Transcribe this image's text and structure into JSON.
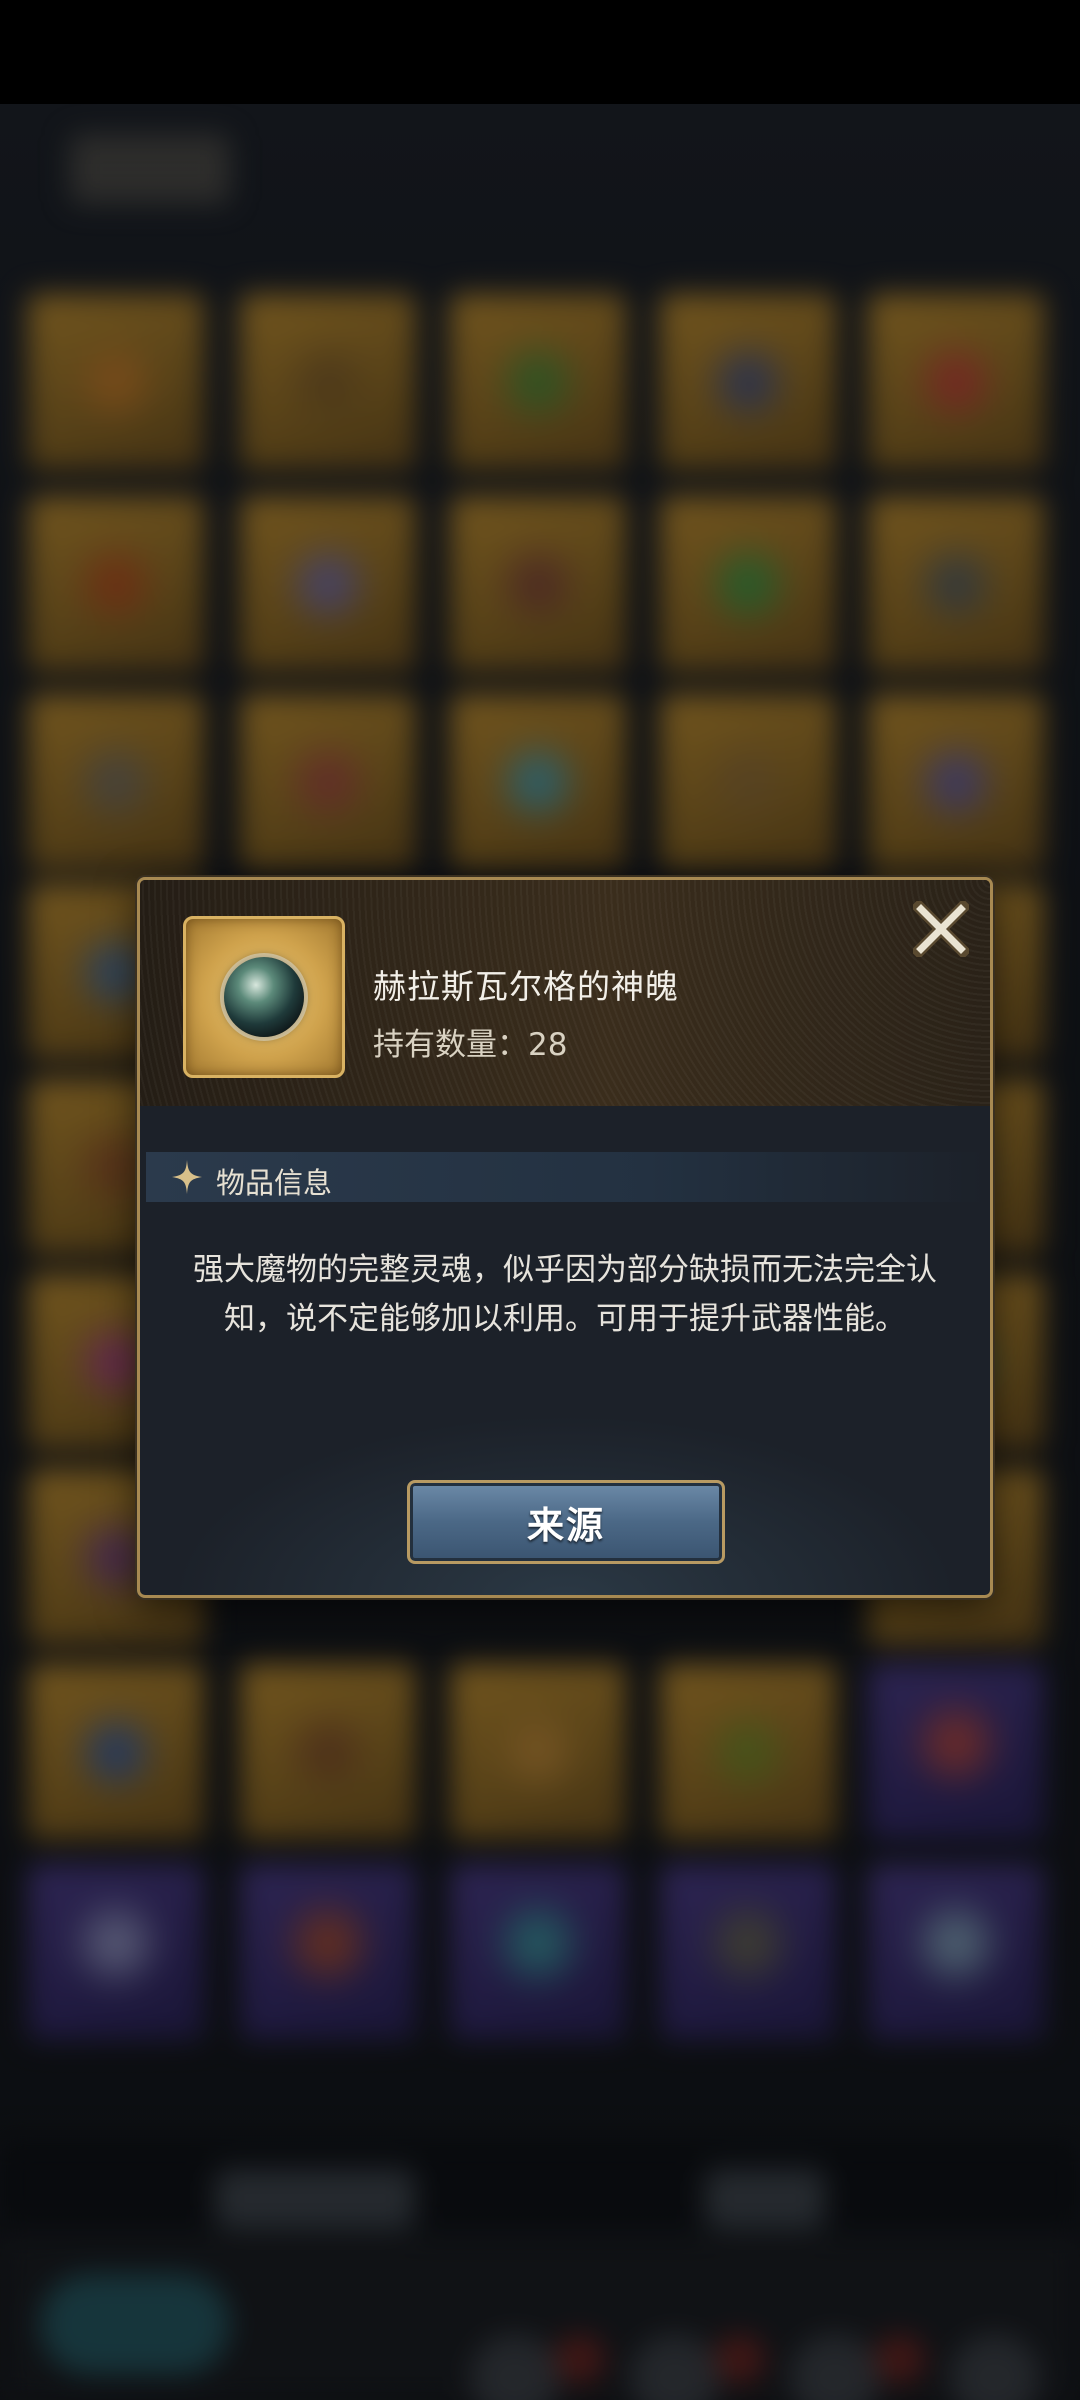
{
  "item": {
    "name": "赫拉斯瓦尔格的神魄",
    "count_label": "持有数量：28",
    "icon": "soul-orb-icon"
  },
  "section": {
    "title": "物品信息",
    "icon": "sparkle-icon"
  },
  "description": "强大魔物的完整灵魂，似乎因为部分缺损而无法完全认知，说不定能够加以利用。可用于提升武器性能。",
  "buttons": {
    "source_label": "来源",
    "close_icon": "close-icon"
  },
  "colors": {
    "frame_gold": "#a88a52",
    "item_gold": "#d9b262",
    "button_blue": "#4b6886",
    "dialog_bg": "#1c2129"
  }
}
